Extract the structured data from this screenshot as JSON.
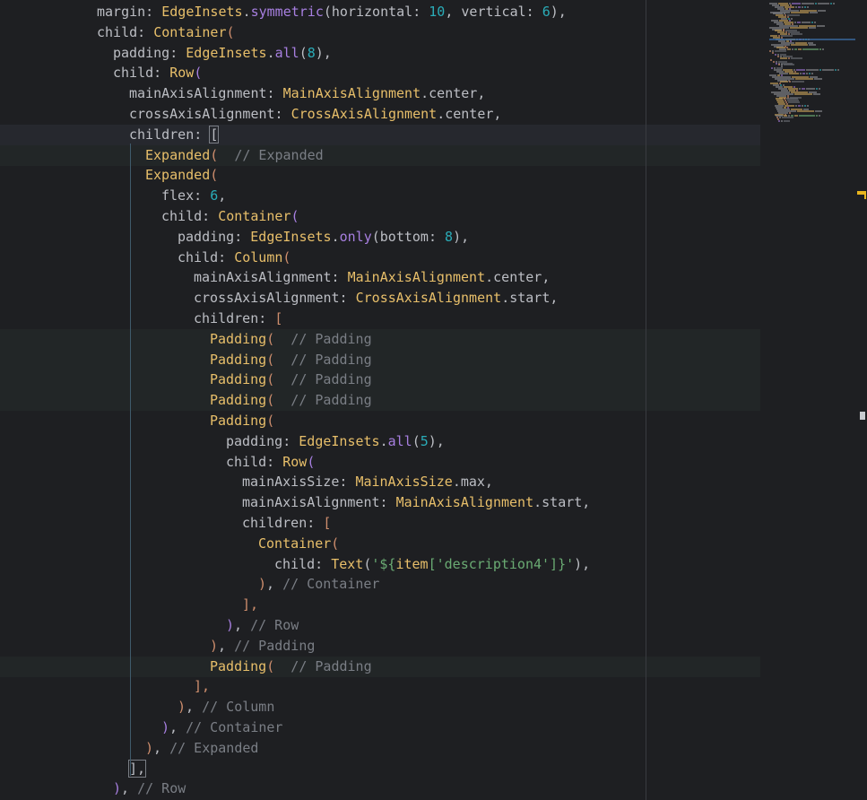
{
  "editor": {
    "lines": [
      {
        "indent": 6,
        "tokens": [
          {
            "t": "margin: ",
            "c": "plain"
          },
          {
            "t": "EdgeInsets",
            "c": "class"
          },
          {
            "t": ".",
            "c": "plain"
          },
          {
            "t": "symmetric",
            "c": "func"
          },
          {
            "t": "(horizontal: ",
            "c": "plain"
          },
          {
            "t": "10",
            "c": "num"
          },
          {
            "t": ", vertical: ",
            "c": "plain"
          },
          {
            "t": "6",
            "c": "num"
          },
          {
            "t": "),",
            "c": "plain"
          }
        ]
      },
      {
        "indent": 6,
        "tokens": [
          {
            "t": "child: ",
            "c": "plain"
          },
          {
            "t": "Container",
            "c": "class"
          },
          {
            "t": "(",
            "c": "brace"
          }
        ]
      },
      {
        "indent": 7,
        "tokens": [
          {
            "t": "padding: ",
            "c": "plain"
          },
          {
            "t": "EdgeInsets",
            "c": "class"
          },
          {
            "t": ".",
            "c": "plain"
          },
          {
            "t": "all",
            "c": "func"
          },
          {
            "t": "(",
            "c": "plain"
          },
          {
            "t": "8",
            "c": "num"
          },
          {
            "t": "),",
            "c": "plain"
          }
        ]
      },
      {
        "indent": 7,
        "tokens": [
          {
            "t": "child: ",
            "c": "plain"
          },
          {
            "t": "Row",
            "c": "class"
          },
          {
            "t": "(",
            "c": "func"
          }
        ]
      },
      {
        "indent": 8,
        "tokens": [
          {
            "t": "mainAxisAlignment: ",
            "c": "plain"
          },
          {
            "t": "MainAxisAlignment",
            "c": "class"
          },
          {
            "t": ".center,",
            "c": "plain"
          }
        ]
      },
      {
        "indent": 8,
        "tokens": [
          {
            "t": "crossAxisAlignment: ",
            "c": "plain"
          },
          {
            "t": "CrossAxisAlignment",
            "c": "class"
          },
          {
            "t": ".center,",
            "c": "plain"
          }
        ]
      },
      {
        "indent": 8,
        "hl": "caret",
        "tokens": [
          {
            "t": "children: ",
            "c": "plain"
          },
          {
            "t": "[",
            "c": "bracket-hl"
          }
        ]
      },
      {
        "indent": 9,
        "hl": "foldrow",
        "tokens": [
          {
            "t": "Expanded",
            "c": "class"
          },
          {
            "t": "(",
            "c": "brace"
          },
          {
            "t": "  // Expanded",
            "c": "comment"
          }
        ]
      },
      {
        "indent": 9,
        "tokens": [
          {
            "t": "Expanded",
            "c": "class"
          },
          {
            "t": "(",
            "c": "brace"
          }
        ]
      },
      {
        "indent": 10,
        "tokens": [
          {
            "t": "flex: ",
            "c": "plain"
          },
          {
            "t": "6",
            "c": "num"
          },
          {
            "t": ",",
            "c": "plain"
          }
        ]
      },
      {
        "indent": 10,
        "tokens": [
          {
            "t": "child: ",
            "c": "plain"
          },
          {
            "t": "Container",
            "c": "class"
          },
          {
            "t": "(",
            "c": "func"
          }
        ]
      },
      {
        "indent": 11,
        "tokens": [
          {
            "t": "padding: ",
            "c": "plain"
          },
          {
            "t": "EdgeInsets",
            "c": "class"
          },
          {
            "t": ".",
            "c": "plain"
          },
          {
            "t": "only",
            "c": "func"
          },
          {
            "t": "(bottom: ",
            "c": "plain"
          },
          {
            "t": "8",
            "c": "num"
          },
          {
            "t": "),",
            "c": "plain"
          }
        ]
      },
      {
        "indent": 11,
        "tokens": [
          {
            "t": "child: ",
            "c": "plain"
          },
          {
            "t": "Column",
            "c": "class"
          },
          {
            "t": "(",
            "c": "brace"
          }
        ]
      },
      {
        "indent": 12,
        "tokens": [
          {
            "t": "mainAxisAlignment: ",
            "c": "plain"
          },
          {
            "t": "MainAxisAlignment",
            "c": "class"
          },
          {
            "t": ".center,",
            "c": "plain"
          }
        ]
      },
      {
        "indent": 12,
        "tokens": [
          {
            "t": "crossAxisAlignment: ",
            "c": "plain"
          },
          {
            "t": "CrossAxisAlignment",
            "c": "class"
          },
          {
            "t": ".start,",
            "c": "plain"
          }
        ]
      },
      {
        "indent": 12,
        "tokens": [
          {
            "t": "children: ",
            "c": "plain"
          },
          {
            "t": "[",
            "c": "brace"
          }
        ]
      },
      {
        "indent": 13,
        "hl": "foldrow",
        "tokens": [
          {
            "t": "Padding",
            "c": "class"
          },
          {
            "t": "(",
            "c": "brace"
          },
          {
            "t": "  // Padding",
            "c": "comment"
          }
        ]
      },
      {
        "indent": 13,
        "hl": "foldrow",
        "tokens": [
          {
            "t": "Padding",
            "c": "class"
          },
          {
            "t": "(",
            "c": "brace"
          },
          {
            "t": "  // Padding",
            "c": "comment"
          }
        ]
      },
      {
        "indent": 13,
        "hl": "foldrow",
        "tokens": [
          {
            "t": "Padding",
            "c": "class"
          },
          {
            "t": "(",
            "c": "brace"
          },
          {
            "t": "  // Padding",
            "c": "comment"
          }
        ]
      },
      {
        "indent": 13,
        "hl": "foldrow",
        "tokens": [
          {
            "t": "Padding",
            "c": "class"
          },
          {
            "t": "(",
            "c": "brace"
          },
          {
            "t": "  // Padding",
            "c": "comment"
          }
        ]
      },
      {
        "indent": 13,
        "tokens": [
          {
            "t": "Padding",
            "c": "class"
          },
          {
            "t": "(",
            "c": "brace"
          }
        ]
      },
      {
        "indent": 14,
        "tokens": [
          {
            "t": "padding: ",
            "c": "plain"
          },
          {
            "t": "EdgeInsets",
            "c": "class"
          },
          {
            "t": ".",
            "c": "plain"
          },
          {
            "t": "all",
            "c": "func"
          },
          {
            "t": "(",
            "c": "plain"
          },
          {
            "t": "5",
            "c": "num"
          },
          {
            "t": "),",
            "c": "plain"
          }
        ]
      },
      {
        "indent": 14,
        "tokens": [
          {
            "t": "child: ",
            "c": "plain"
          },
          {
            "t": "Row",
            "c": "class"
          },
          {
            "t": "(",
            "c": "func"
          }
        ]
      },
      {
        "indent": 15,
        "tokens": [
          {
            "t": "mainAxisSize: ",
            "c": "plain"
          },
          {
            "t": "MainAxisSize",
            "c": "class"
          },
          {
            "t": ".max,",
            "c": "plain"
          }
        ]
      },
      {
        "indent": 15,
        "tokens": [
          {
            "t": "mainAxisAlignment: ",
            "c": "plain"
          },
          {
            "t": "MainAxisAlignment",
            "c": "class"
          },
          {
            "t": ".start,",
            "c": "plain"
          }
        ]
      },
      {
        "indent": 15,
        "tokens": [
          {
            "t": "children: ",
            "c": "plain"
          },
          {
            "t": "[",
            "c": "brace"
          }
        ]
      },
      {
        "indent": 16,
        "tokens": [
          {
            "t": "Container",
            "c": "class"
          },
          {
            "t": "(",
            "c": "brace"
          }
        ]
      },
      {
        "indent": 17,
        "tokens": [
          {
            "t": "child: ",
            "c": "plain"
          },
          {
            "t": "Text",
            "c": "class"
          },
          {
            "t": "(",
            "c": "plain"
          },
          {
            "t": "'${",
            "c": "str"
          },
          {
            "t": "item",
            "c": "class"
          },
          {
            "t": "['description4']",
            "c": "str"
          },
          {
            "t": "}'",
            "c": "str"
          },
          {
            "t": "),",
            "c": "plain"
          }
        ]
      },
      {
        "indent": 16,
        "tokens": [
          {
            "t": ")",
            "c": "brace"
          },
          {
            "t": ", ",
            "c": "plain"
          },
          {
            "t": "// Container",
            "c": "comment"
          }
        ]
      },
      {
        "indent": 15,
        "tokens": [
          {
            "t": "],",
            "c": "brace"
          }
        ]
      },
      {
        "indent": 14,
        "tokens": [
          {
            "t": ")",
            "c": "func"
          },
          {
            "t": ", ",
            "c": "plain"
          },
          {
            "t": "// Row",
            "c": "comment"
          }
        ]
      },
      {
        "indent": 13,
        "tokens": [
          {
            "t": ")",
            "c": "brace"
          },
          {
            "t": ", ",
            "c": "plain"
          },
          {
            "t": "// Padding",
            "c": "comment"
          }
        ]
      },
      {
        "indent": 13,
        "hl": "foldrow",
        "tokens": [
          {
            "t": "Padding",
            "c": "class"
          },
          {
            "t": "(",
            "c": "brace"
          },
          {
            "t": "  // Padding",
            "c": "comment"
          }
        ]
      },
      {
        "indent": 12,
        "tokens": [
          {
            "t": "],",
            "c": "brace"
          }
        ]
      },
      {
        "indent": 11,
        "tokens": [
          {
            "t": ")",
            "c": "brace"
          },
          {
            "t": ", ",
            "c": "plain"
          },
          {
            "t": "// Column",
            "c": "comment"
          }
        ]
      },
      {
        "indent": 10,
        "tokens": [
          {
            "t": ")",
            "c": "func"
          },
          {
            "t": ", ",
            "c": "plain"
          },
          {
            "t": "// Container",
            "c": "comment"
          }
        ]
      },
      {
        "indent": 9,
        "tokens": [
          {
            "t": ")",
            "c": "brace"
          },
          {
            "t": ", ",
            "c": "plain"
          },
          {
            "t": "// Expanded",
            "c": "comment"
          }
        ]
      },
      {
        "indent": 8,
        "tokens": [
          {
            "t": "],",
            "c": "bracket-hl"
          }
        ]
      },
      {
        "indent": 7,
        "tokens": [
          {
            "t": ")",
            "c": "func"
          },
          {
            "t": ", ",
            "c": "plain"
          },
          {
            "t": "// Row",
            "c": "comment"
          }
        ]
      }
    ]
  },
  "gutter": {
    "icon": "lightbulb-icon"
  },
  "colors": {
    "background": "#1e1f22",
    "class": "#e8bf6a",
    "function": "#a77fe0",
    "number": "#2aacb8",
    "string": "#6aab73",
    "brace": "#cf8e6d",
    "comment": "#7a7e85",
    "warning_marker": "#e8b41d"
  },
  "minimap": {
    "icon": "minimap"
  }
}
